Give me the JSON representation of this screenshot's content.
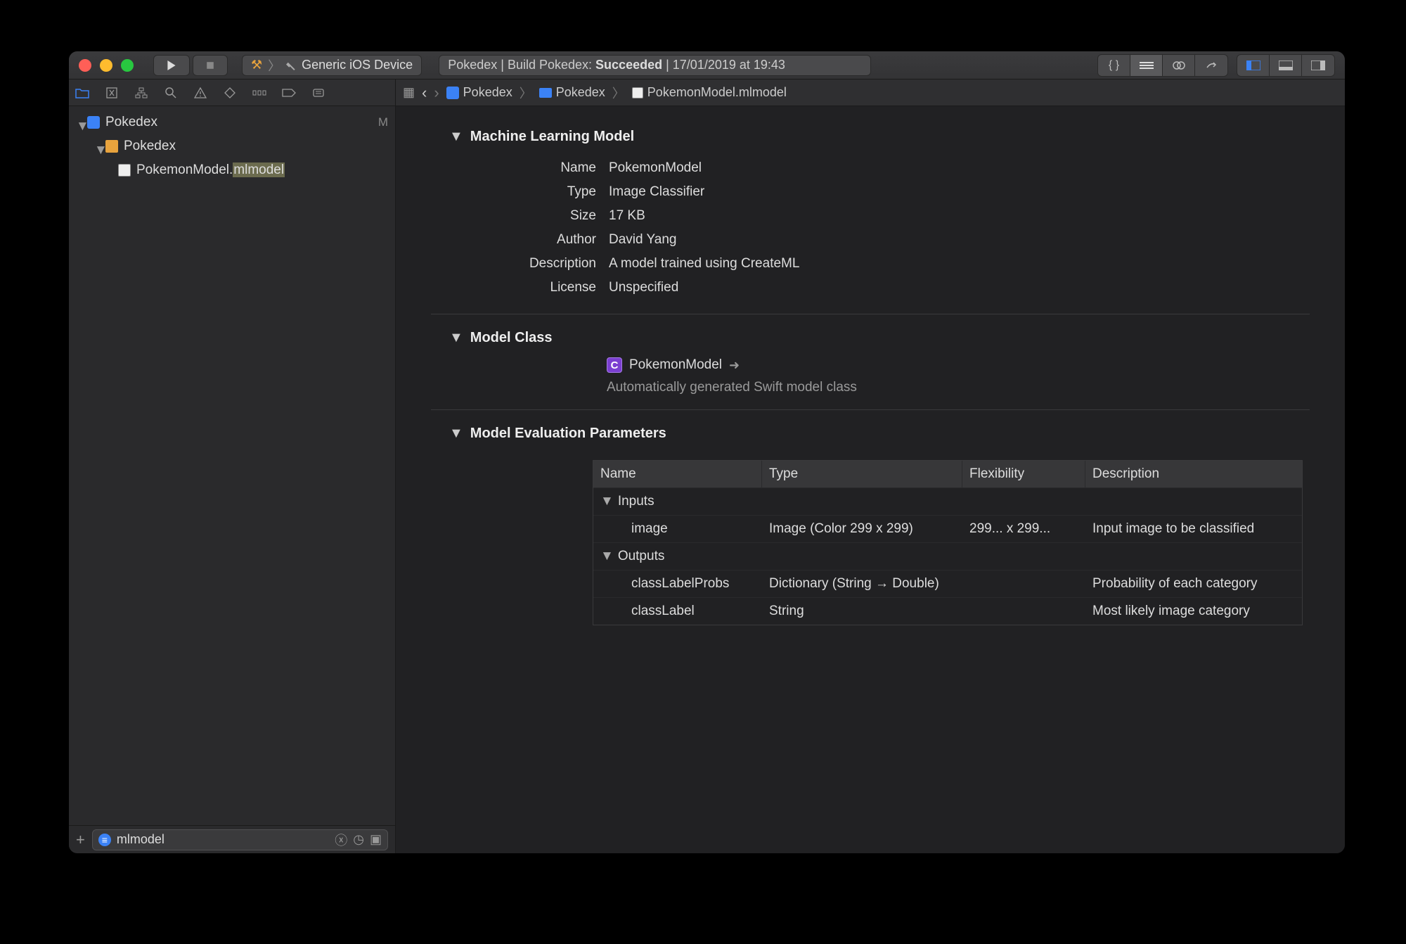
{
  "scheme": "Generic iOS Device",
  "status": {
    "project": "Pokedex",
    "action": "Build Pokedex:",
    "result": "Succeeded",
    "timestamp": "17/01/2019 at 19:43"
  },
  "breadcrumb": [
    "Pokedex",
    "Pokedex",
    "PokemonModel.mlmodel"
  ],
  "tree": {
    "root": {
      "name": "Pokedex",
      "badge": "M"
    },
    "group": {
      "name": "Pokedex"
    },
    "file": {
      "prefix": "PokemonModel.",
      "hl": "mlmodel"
    }
  },
  "filter": {
    "value": "mlmodel"
  },
  "mlm": {
    "sectionTitle": "Machine Learning Model",
    "name_label": "Name",
    "name": "PokemonModel",
    "type_label": "Type",
    "type": "Image Classifier",
    "size_label": "Size",
    "size": "17 KB",
    "author_label": "Author",
    "author": "David Yang",
    "desc_label": "Description",
    "desc": "A model trained using CreateML",
    "license_label": "License",
    "license": "Unspecified"
  },
  "mc": {
    "sectionTitle": "Model Class",
    "className": "PokemonModel",
    "sub": "Automatically generated Swift model class"
  },
  "mep": {
    "sectionTitle": "Model Evaluation Parameters",
    "headers": {
      "name": "Name",
      "type": "Type",
      "flex": "Flexibility",
      "desc": "Description"
    },
    "inputsLabel": "Inputs",
    "outputsLabel": "Outputs",
    "inputs": [
      {
        "name": "image",
        "type": "Image (Color 299 x 299)",
        "flex": "299... x 299...",
        "desc": "Input image to be classified"
      }
    ],
    "outputs": [
      {
        "name": "classLabelProbs",
        "type": "Dictionary (String → Double)",
        "flex": "",
        "desc": "Probability of each category"
      },
      {
        "name": "classLabel",
        "type": "String",
        "flex": "",
        "desc": "Most likely image category"
      }
    ]
  }
}
